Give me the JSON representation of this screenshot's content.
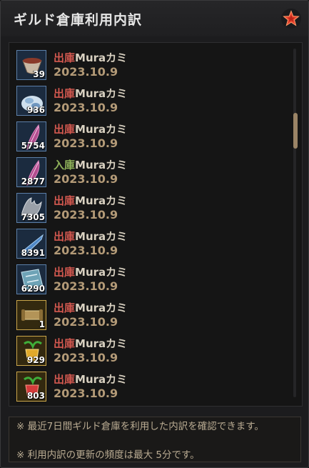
{
  "title": "ギルド倉庫利用内訳",
  "close_icon": "star-close-icon",
  "entries": [
    {
      "icon": "bowl-icon",
      "qty": "39",
      "action": "出庫",
      "user": "Muraカミ",
      "date": "2023.10.9",
      "frame": "blue"
    },
    {
      "icon": "ore-icon",
      "qty": "936",
      "action": "出庫",
      "user": "Muraカミ",
      "date": "2023.10.9",
      "frame": "blue"
    },
    {
      "icon": "feather-icon",
      "qty": "5754",
      "action": "出庫",
      "user": "Muraカミ",
      "date": "2023.10.9",
      "frame": "blue"
    },
    {
      "icon": "feather-icon",
      "qty": "2877",
      "action": "入庫",
      "user": "Muraカミ",
      "date": "2023.10.9",
      "frame": "blue"
    },
    {
      "icon": "claw-icon",
      "qty": "7305",
      "action": "出庫",
      "user": "Muraカミ",
      "date": "2023.10.9",
      "frame": "blue"
    },
    {
      "icon": "horn-icon",
      "qty": "8391",
      "action": "出庫",
      "user": "Muraカミ",
      "date": "2023.10.9",
      "frame": "blue"
    },
    {
      "icon": "map-icon",
      "qty": "6290",
      "action": "出庫",
      "user": "Muraカミ",
      "date": "2023.10.9",
      "frame": "blue"
    },
    {
      "icon": "scroll-icon",
      "qty": "1",
      "action": "出庫",
      "user": "Muraカミ",
      "date": "2023.10.9",
      "frame": "gold"
    },
    {
      "icon": "drink-yellow-icon",
      "qty": "929",
      "action": "出庫",
      "user": "Muraカミ",
      "date": "2023.10.9",
      "frame": "gold"
    },
    {
      "icon": "drink-red-icon",
      "qty": "803",
      "action": "出庫",
      "user": "Muraカミ",
      "date": "2023.10.9",
      "frame": "gold"
    }
  ],
  "notice": {
    "line1": "※ 最近7日間ギルド倉庫を利用した内訳を確認できます。",
    "line2": "※ 利用内訳の更新の頻度は最大 5分です。"
  },
  "colors": {
    "out": "#d2584f",
    "in": "#8fb25a",
    "date": "#b39a77"
  }
}
